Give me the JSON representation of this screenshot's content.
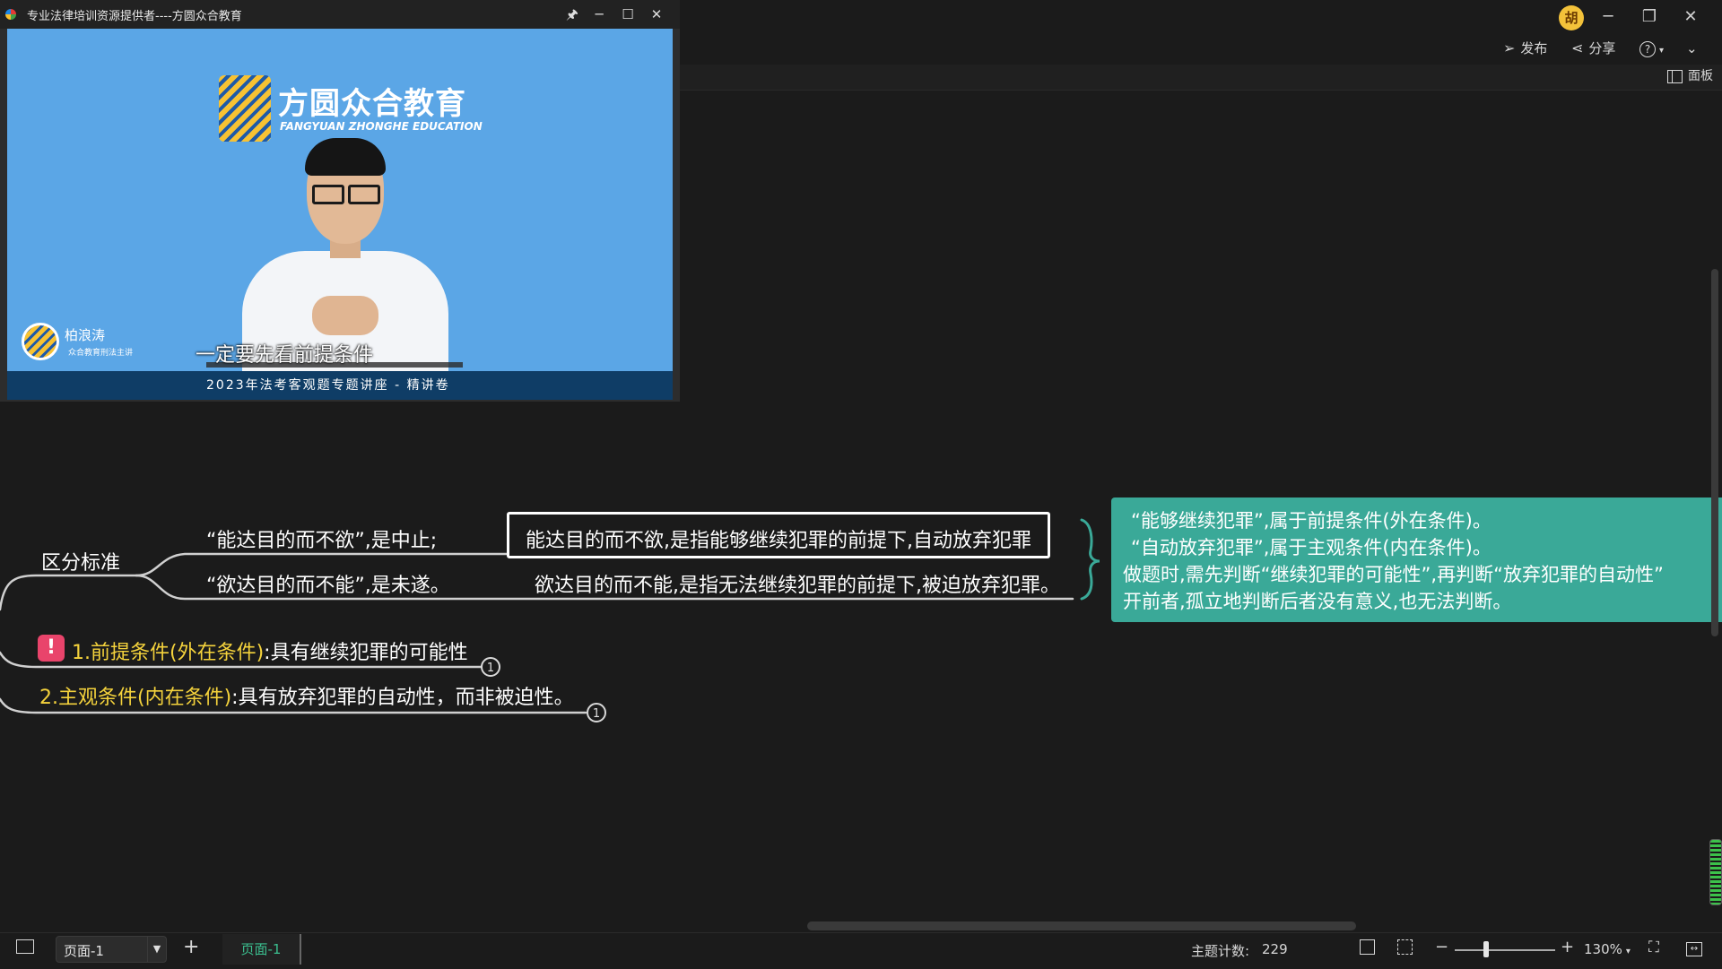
{
  "app": {
    "avatar_text": "胡",
    "window_controls": {
      "minimize": "─",
      "restore": "❐",
      "close": "✕"
    },
    "toolbar": {
      "publish": "发布",
      "share": "分享",
      "help": "?",
      "more": "⌄",
      "panel": "面板"
    }
  },
  "video_window": {
    "title": "专业法律培训资源提供者----方圆众合教育",
    "controls": {
      "pin": "🖈",
      "minimize": "─",
      "maximize": "☐",
      "close": "✕"
    },
    "logo_name": "方圆众合教育",
    "logo_sub": "FANGYUAN ZHONGHE EDUCATION",
    "speaker_name": "柏浪涛",
    "speaker_role": "众合教育刑法主讲",
    "subtitle": "一定要先看前提条件",
    "lecture_title": "2023年法考客观题专题讲座 - 精讲卷"
  },
  "mindmap": {
    "branch_label": "区分标准",
    "item_1": "“能达目的而不欲”,是中止;",
    "item_2": "“欲达目的而不能”,是未遂。",
    "detail_1": "能达目的而不欲,是指能够继续犯罪的前提下,自动放弃犯罪",
    "detail_2": "欲达目的而不能,是指无法继续犯罪的前提下,被迫放弃犯罪。",
    "note_lines": [
      "“能够继续犯罪”,属于前提条件(外在条件)。",
      "“自动放弃犯罪”,属于主观条件(内在条件)。",
      "做题时,需先判断“继续犯罪的可能性”,再判断“放弃犯罪的自动性”",
      "开前者,孤立地判断后者没有意义,也无法判断。"
    ],
    "condition_1_title": "1.前提条件(外在条件)",
    "condition_1_text": ":具有继续犯罪的可能性",
    "condition_2_title": "2.主观条件(内在条件)",
    "condition_2_text": ":具有放弃犯罪的自动性，而非被迫性。",
    "collapse_count_1": "1",
    "collapse_count_2": "1",
    "alert_mark": "!"
  },
  "statusbar": {
    "page_select_value": "页面-1",
    "add_page": "+",
    "active_tab": "页面-1",
    "topic_count_label": "主题计数:",
    "topic_count_value": "229",
    "zoom_minus": "−",
    "zoom_plus": "+",
    "zoom_level": "130%"
  },
  "colors": {
    "background": "#1b1b1b",
    "accent_teal": "#3aa998",
    "highlight_yellow": "#f5d33c",
    "alert_pink": "#e9446b",
    "tab_green": "#3bbf8f"
  }
}
